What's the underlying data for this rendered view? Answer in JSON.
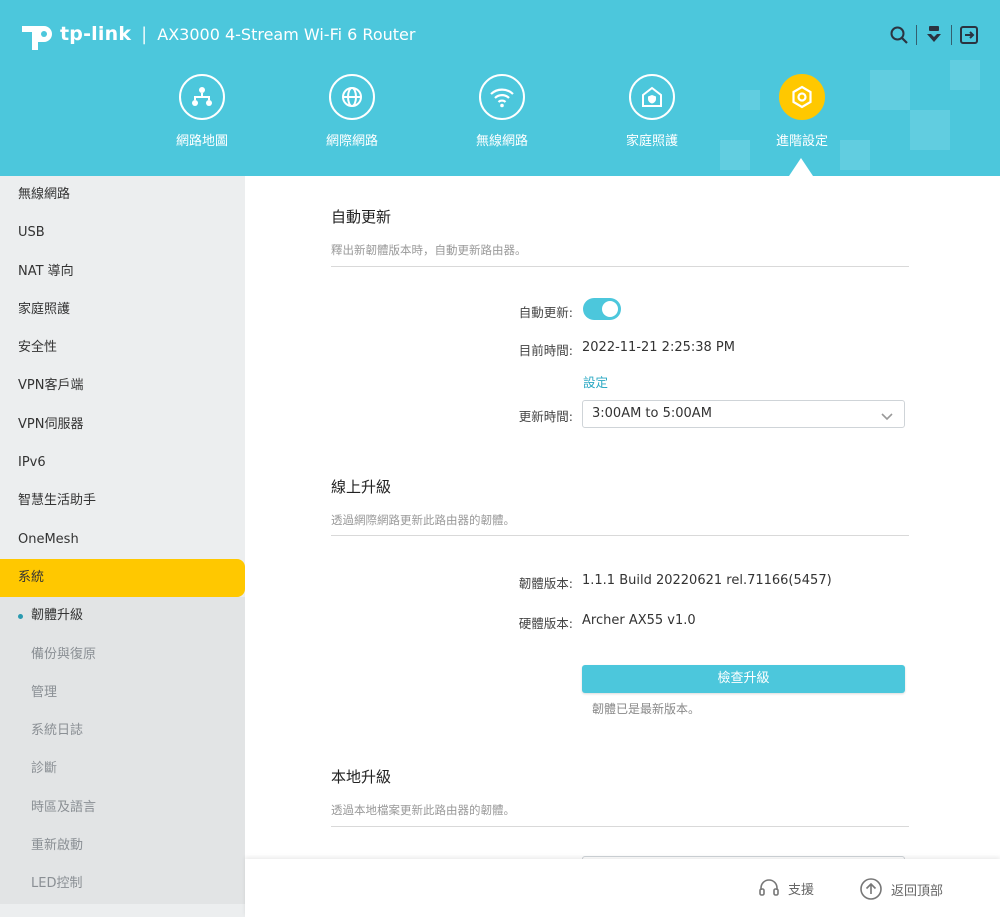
{
  "header": {
    "brand": "tp-link",
    "separator": "|",
    "model": "AX3000 4-Stream Wi-Fi 6 Router",
    "nav": [
      {
        "label": "網路地圖",
        "icon": "network-map-icon"
      },
      {
        "label": "網際網路",
        "icon": "globe-icon"
      },
      {
        "label": "無線網路",
        "icon": "wifi-icon"
      },
      {
        "label": "家庭照護",
        "icon": "home-shield-icon"
      },
      {
        "label": "進階設定",
        "icon": "gear-icon"
      }
    ]
  },
  "sidebar": {
    "items": [
      "無線網路",
      "USB",
      "NAT 導向",
      "家庭照護",
      "安全性",
      "VPN客戶端",
      "VPN伺服器",
      "IPv6",
      "智慧生活助手",
      "OneMesh",
      "系統"
    ],
    "sub_items": [
      "韌體升級",
      "備份與復原",
      "管理",
      "系統日誌",
      "診斷",
      "時區及語言",
      "重新啟動",
      "LED控制"
    ]
  },
  "auto_update": {
    "title": "自動更新",
    "desc": "釋出新韌體版本時，自動更新路由器。",
    "toggle_label": "自動更新:",
    "time_label": "目前時間:",
    "time_value": "2022-11-21 2:25:38 PM",
    "set_link": "設定",
    "update_time_label": "更新時間:",
    "update_time_value": "3:00AM to 5:00AM"
  },
  "online_upgrade": {
    "title": "線上升級",
    "desc": "透過網際網路更新此路由器的韌體。",
    "fw_label": "韌體版本:",
    "fw_value": "1.1.1 Build 20220621 rel.71166(5457)",
    "hw_label": "硬體版本:",
    "hw_value": "Archer AX55 v1.0",
    "check_button": "檢查升級",
    "status_note": "韌體已是最新版本。"
  },
  "local_upgrade": {
    "title": "本地升級",
    "desc": "透過本地檔案更新此路由器的韌體。"
  },
  "footer": {
    "support": "支援",
    "back_to_top": "返回頂部"
  },
  "colors": {
    "header": "#4cc7dc",
    "accent": "#ffc800",
    "link": "#2aa8c3"
  }
}
